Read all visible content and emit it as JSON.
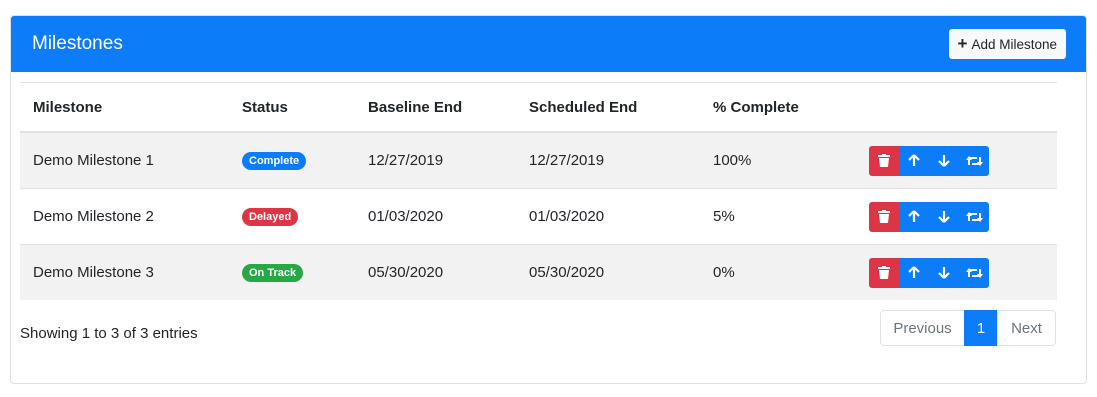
{
  "header": {
    "title": "Milestones",
    "add_label": "Add Milestone"
  },
  "table": {
    "columns": [
      "Milestone",
      "Status",
      "Baseline End",
      "Scheduled End",
      "% Complete",
      ""
    ],
    "rows": [
      {
        "name": "Demo Milestone 1",
        "status": "Complete",
        "baseline": "12/27/2019",
        "scheduled": "12/27/2019",
        "complete": "100%"
      },
      {
        "name": "Demo Milestone 2",
        "status": "Delayed",
        "baseline": "01/03/2020",
        "scheduled": "01/03/2020",
        "complete": "5%"
      },
      {
        "name": "Demo Milestone 3",
        "status": "On Track",
        "baseline": "05/30/2020",
        "scheduled": "05/30/2020",
        "complete": "0%"
      }
    ],
    "row_action_icons": [
      "trash-icon",
      "arrow-up-icon",
      "arrow-down-icon",
      "retweet-icon"
    ]
  },
  "footer": {
    "info": "Showing 1 to 3 of 3 entries",
    "pagination": {
      "previous": "Previous",
      "current": "1",
      "next": "Next"
    }
  },
  "colors": {
    "primary": "#0d7cf8",
    "danger": "#dc3545",
    "success": "#28a745",
    "striped_row": "#f2f2f2"
  }
}
